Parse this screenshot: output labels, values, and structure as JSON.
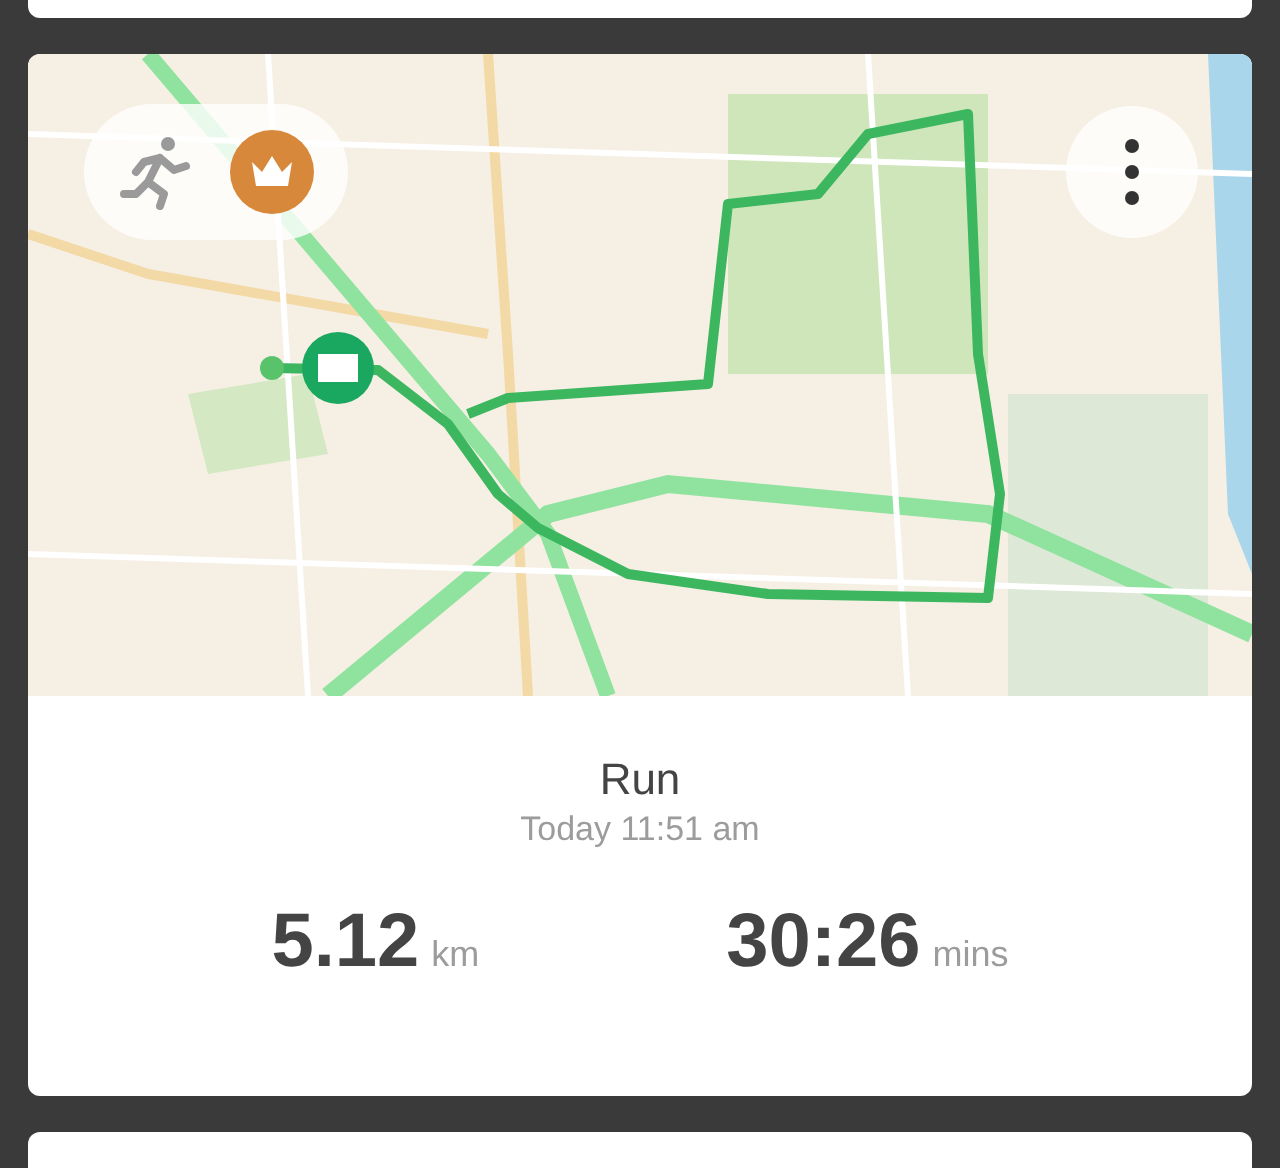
{
  "activity": {
    "title": "Run",
    "time": "Today 11:51 am"
  },
  "stats": [
    {
      "value": "5.12",
      "unit": "km"
    },
    {
      "value": "30:26",
      "unit": "mins"
    }
  ]
}
